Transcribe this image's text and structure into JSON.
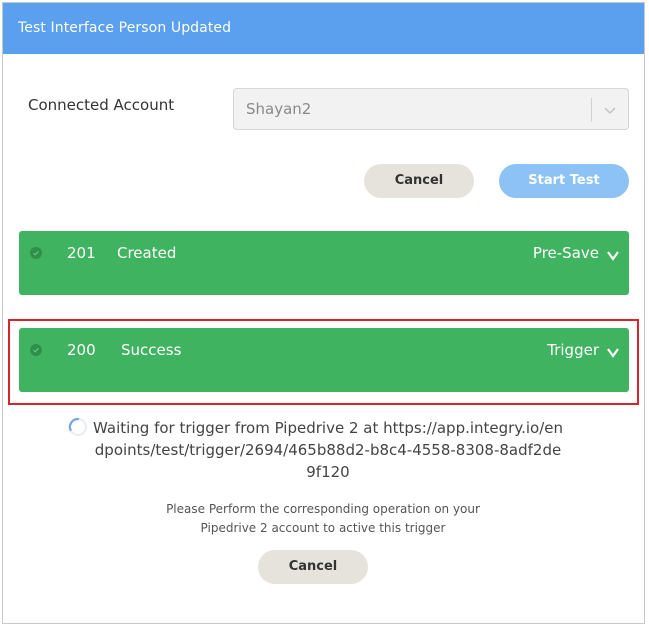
{
  "dialog": {
    "title": "Test Interface Person Updated"
  },
  "account": {
    "label": "Connected Account",
    "value": "Shayan2"
  },
  "actions": {
    "cancel_label": "Cancel",
    "start_label": "Start Test"
  },
  "results": [
    {
      "code": "201",
      "status": "Created",
      "stage": "Pre-Save",
      "highlighted": false
    },
    {
      "code": "200",
      "status": "Success",
      "stage": "Trigger",
      "highlighted": true
    }
  ],
  "waiting": {
    "text": "Waiting for trigger from Pipedrive 2 at https://app.integry.io/endpoints/test/trigger/2694/465b88d2-b8c4-4558-8308-8adf2de9f120"
  },
  "instruction": {
    "text": "Please Perform the corresponding operation on your Pipedrive 2 account to active this trigger"
  },
  "footer": {
    "cancel_label": "Cancel"
  },
  "colors": {
    "header": "#5aa0ee",
    "success": "#3fb35f",
    "highlight_border": "#d7262b",
    "start_button": "#8cc2f6"
  },
  "icons": {
    "select_chevron": "chevron-down-icon",
    "status": "check-circle-icon",
    "expand": "chevron-down-icon",
    "loading": "spinner-icon"
  }
}
